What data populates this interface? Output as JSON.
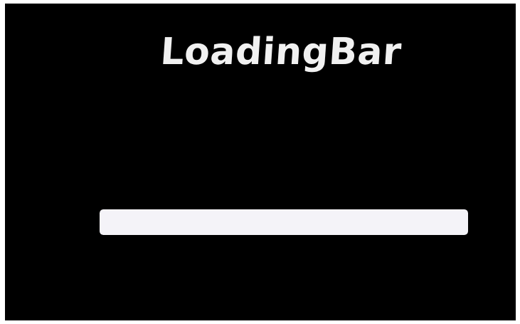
{
  "window": {
    "background": "#000000"
  },
  "title": {
    "text": "LoadingBar",
    "color": "#f1f1f1"
  },
  "loading_bar": {
    "progress": 1.0,
    "fill_color": "#f4f3f8"
  }
}
